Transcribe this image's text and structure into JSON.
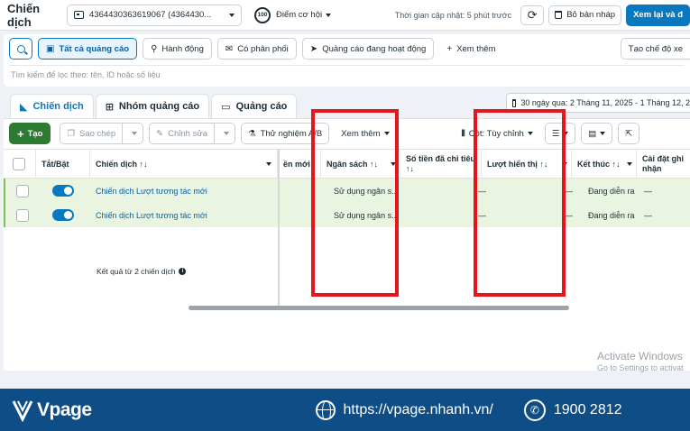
{
  "topbar": {
    "title": "Chiến dịch",
    "account": "4364430363619067 (4364430...",
    "score_badge": "100",
    "score_label": "Điểm cơ hội",
    "updated": "Thời gian cập nhật: 5 phút trước",
    "discard_label": "Bỏ bản nháp",
    "review_label": "Xem lại và đ"
  },
  "filters": {
    "pills": [
      "Tất cả quảng cáo",
      "Hành động",
      "Có phân phối",
      "Quảng cáo đang hoạt động"
    ],
    "see_more": "Xem thêm",
    "mode": "Tạo chế độ xe",
    "placeholder": "Tìm kiếm để lọc theo: tên, ID hoặc số liệu"
  },
  "tabs": [
    "Chiến dịch",
    "Nhóm quảng cáo",
    "Quảng cáo"
  ],
  "date_range": "30 ngày qua: 2 Tháng 11, 2025 - 1 Tháng 12, 2",
  "toolbar": {
    "create": "Tạo",
    "copy": "Sao chép",
    "edit": "Chỉnh sửa",
    "ab_test": "Thử nghiệm A/B",
    "see_more": "Xem thêm",
    "columns": "Cột: Tùy chỉnh"
  },
  "table": {
    "headers": {
      "toggle": "Tắt/Bật",
      "campaign": "Chiến dịch ↑↓",
      "new": "ền mới",
      "budget": "Ngân sách ↑↓",
      "spend": "Số tiền đã chi tiêu ↑↓",
      "impressions": "Lượt hiển thị ↑↓",
      "end": "Kết thúc ↑↓",
      "attribution": "Cài đặt ghi nhận"
    },
    "rows": [
      {
        "name": "Chiến dịch Lượt tương tác mới",
        "budget": "Sử dụng ngân s...",
        "end": "Đang diễn ra",
        "attribution": "—"
      },
      {
        "name": "Chiến dịch Lượt tương tác mới",
        "budget": "Sử dụng ngân s...",
        "end": "Đang diễn ra",
        "attribution": "—"
      }
    ],
    "dashes": [
      "—",
      "—",
      "—",
      "—",
      "—",
      "—"
    ],
    "summary": "Kết quả từ 2 chiến dịch"
  },
  "watermark": {
    "line1": "Activate Windows",
    "line2": "Go to Settings to activat"
  },
  "footer": {
    "brand": "Vpage",
    "website": "https://vpage.nhanh.vn/",
    "phone": "1900 2812"
  },
  "colors": {
    "accent": "#0a78be",
    "create": "#2f7a33",
    "highlight": "#e8141b",
    "footer": "#0e4d86"
  }
}
